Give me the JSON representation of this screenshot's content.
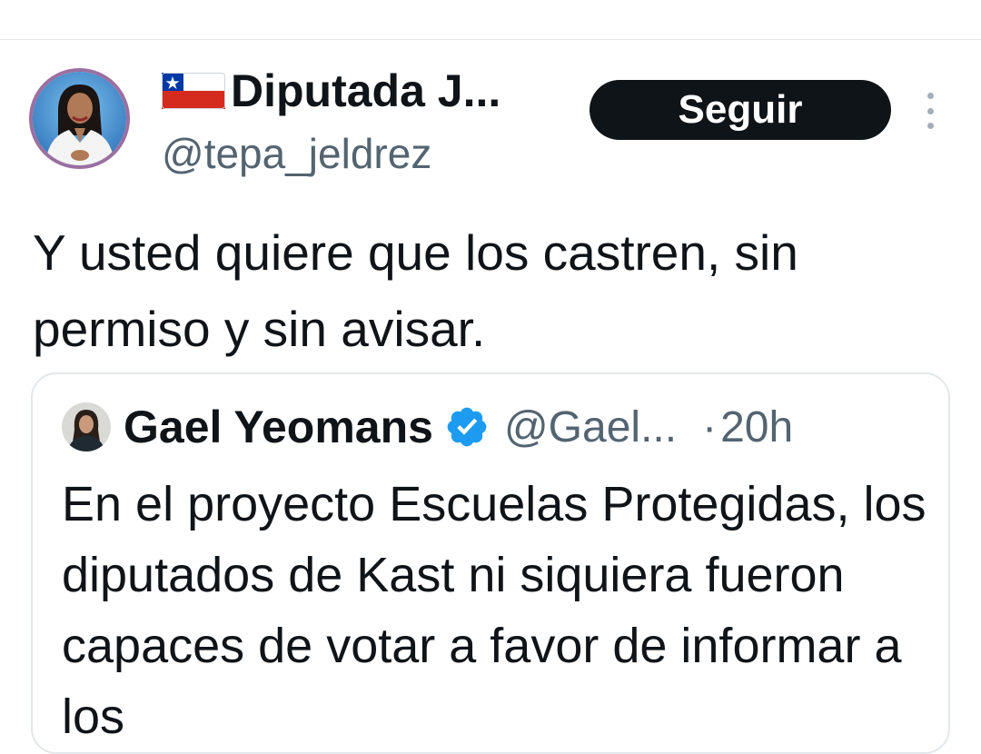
{
  "author": {
    "display_name": "Diputada J...",
    "handle": "@tepa_jeldrez",
    "flag_icon": "chile-flag-icon"
  },
  "follow_label": "Seguir",
  "tweet": {
    "text": "Y usted quiere que los castren, sin permiso y sin avisar."
  },
  "quoted": {
    "display_name": "Gael Yeomans",
    "handle": "@Gael...",
    "separator": "·",
    "time": "20h",
    "text": "En el proyecto Escuelas Protegidas, los diputados de Kast ni siquiera fueron capaces de votar a favor de informar a los"
  },
  "colors": {
    "text": "#0f1419",
    "secondary": "#536471",
    "button_bg": "#0f1419",
    "verified": "#1d9bf0",
    "border": "#e3e7eb"
  }
}
